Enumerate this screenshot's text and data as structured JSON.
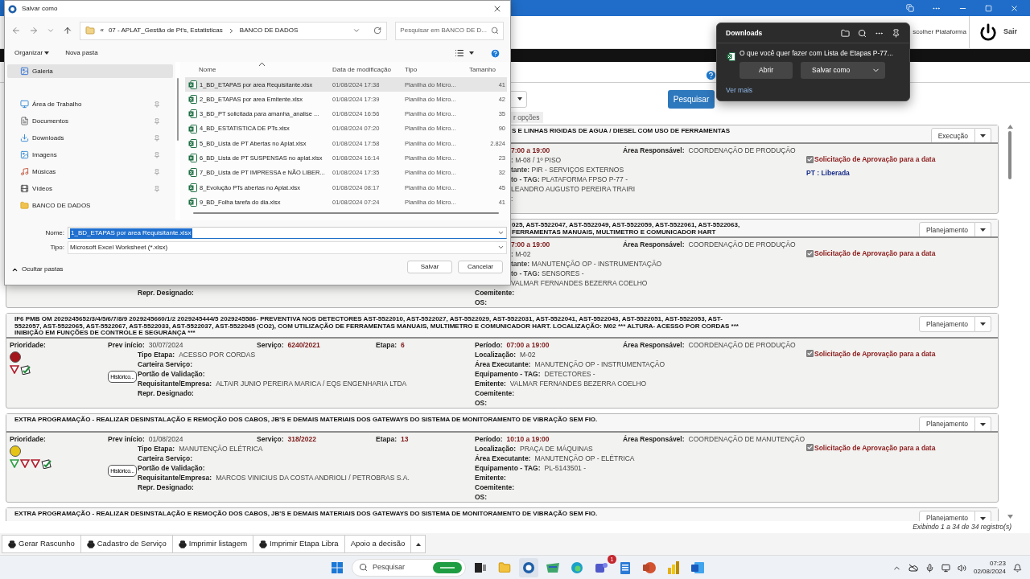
{
  "header": {
    "platform_link": "scolher Plataforma",
    "exit_label": "Sair"
  },
  "search": {
    "button": "Pesquisar",
    "tab": "r opções"
  },
  "cards": [
    {
      "kind": "partial",
      "title": "S E LINHAS RIGIDAS DE AGUA / DIESEL COM USO DE FERRAMENTAS",
      "status": "Execução",
      "rows": [
        {
          "mid": {
            "kind": "fragment",
            "text": "7:00 a 19:00"
          }
        },
        {
          "mid": {
            "kind": "fragment",
            "text": "**:** M-08 / 1º PISO"
          }
        },
        {
          "mid": {
            "kind": "fragment",
            "text": "**tante:** PIR - SERVIÇOS EXTERNOS"
          }
        },
        {
          "mid": {
            "kind": "fragment",
            "text": "**to - TAG:** PLATAFORMA FPSO P-77 -"
          }
        },
        {
          "mid": {
            "kind": "fragment",
            "text": "LEANDRO AUGUSTO PEREIRA TRAIRI"
          }
        },
        {
          "mid": {
            "kind": "fragment",
            "text": ":"
          }
        }
      ],
      "area": {
        "label": "Área Responsável:",
        "value": "COORDENAÇÃO DE PRODUÇÃO"
      },
      "approval": {
        "checked": true,
        "text": "Solicitação de Aprovação para a data"
      },
      "pt_status": "PT : Liberada"
    },
    {
      "kind": "partial",
      "title": "025, AST-5522047, AST-5522049, AST-5522059, AST-5522061, AST-5522063,\nFERRAMENTAS MANUAIS, MULTIMETRO E COMUNICADOR HART",
      "status": "Planejamento",
      "rows": [
        {
          "mid": {
            "kind": "fragment",
            "text": "7:00 a 19:00"
          }
        },
        {
          "mid": {
            "kind": "fragment",
            "text": "**:** M-02"
          }
        },
        {
          "mid": {
            "kind": "fragment",
            "text": "**tante:** MANUTENÇÃO OP - INSTRUMENTAÇÃO"
          }
        },
        {
          "mid": {
            "kind": "fragment",
            "text": "**to - TAG:** SENSORES -"
          }
        },
        {
          "mid": {
            "kind": "fragment",
            "text": "VALMAR FERNANDES BEZERRA COELHO"
          }
        },
        {
          "left": {
            "label": "Repr. Designado:"
          },
          "mid": {
            "kind": "field",
            "label": "Coemitente:"
          }
        },
        {
          "mid": {
            "kind": "field",
            "label": "OS:"
          }
        }
      ],
      "area": {
        "label": "Área Responsável:",
        "value": "COORDENAÇÃO DE PRODUÇÃO"
      },
      "approval": {
        "checked": true,
        "text": "Solicitação de Aprovação para a data"
      }
    },
    {
      "kind": "full",
      "title": "IF6 PMB OM 2029245652/3/4/5/6/7/8/9 2029245660/1/2 2029245444/5 2029245586- PREVENTIVA NOS DETECTORES AST-5522010, AST-5522027, AST-5522029, AST-5522031, AST-5522041, AST-5522043, AST-5522051, AST-5522053, AST-\n5522057, AST-5522065, AST-5522067, AST-5522033, AST-5522037, AST-5522045 (CO2), COM UTILIZAÇÃO DE FERRAMENTAS MANUAIS, MULTIMETRO E COMUNICADOR HART. LOCALIZAÇÃO: M02 *** ALTURA- ACESSO POR CORDAS ***\nINIBIÇÃO EM FUNÇÕES DE CONTROLE E SEGURANÇA ***",
      "status": "Planejamento",
      "priority_label": "Prioridade:",
      "color": "#a3161b",
      "flags": [
        {
          "color": "#b01c2c"
        }
      ],
      "history": "Histórico...",
      "prev": {
        "label": "Prev início:",
        "value": "30/07/2024"
      },
      "service": {
        "label": "Serviço:",
        "value": "6240/2021"
      },
      "stage": {
        "label": "Etapa:",
        "value": "6"
      },
      "left_fields": [
        {
          "label": "Tipo Etapa:",
          "value": "ACESSO POR CORDAS"
        },
        {
          "label": "Carteira Serviço:"
        },
        {
          "label": "Portão de Validação:"
        },
        {
          "label": "Requisitante/Empresa:",
          "value": "ALTAIR JUNIO PEREIRA MARICA / EQS ENGENHARIA LTDA"
        },
        {
          "label": "Repr. Designado:"
        }
      ],
      "period": {
        "label": "Período:",
        "value": "07:00 a 19:00"
      },
      "right_fields": [
        {
          "label": "Localização:",
          "value": "M-02"
        },
        {
          "label": "Área Executante:",
          "value": "MANUTENÇÃO OP - INSTRUMENTAÇÃO"
        },
        {
          "label": "Equipamento - TAG:",
          "value": "DETECTORES -"
        },
        {
          "label": "Emitente:",
          "value": "VALMAR FERNANDES BEZERRA COELHO"
        },
        {
          "label": "Coemitente:"
        },
        {
          "label": "OS:"
        }
      ],
      "area": {
        "label": "Área Responsável:",
        "value": "COORDENAÇÃO DE PRODUÇÃO"
      },
      "approval": {
        "checked": true,
        "text": "Solicitação de Aprovação para a data"
      }
    },
    {
      "kind": "full",
      "title": "EXTRA PROGRAMAÇÃO - REALIZAR DESINSTALAÇÃO E REMOÇÃO DOS CABOS, JB'S E DEMAIS MATERIAIS DOS GATEWAYS DO SISTEMA DE MONITORAMENTO DE VIBRAÇÃO SEM FIO.",
      "status": "Planejamento",
      "priority_label": "Prioridade:",
      "color": "#e6c416",
      "flags": [
        {
          "color": "#2f9e44"
        },
        {
          "color": "#b01c2c"
        },
        {
          "color": "#b01c2c"
        }
      ],
      "history": "Histórico...",
      "prev": {
        "label": "Prev início:",
        "value": "01/08/2024"
      },
      "service": {
        "label": "Serviço:",
        "value": "318/2022"
      },
      "stage": {
        "label": "Etapa:",
        "value": "13"
      },
      "left_fields": [
        {
          "label": "Tipo Etapa:",
          "value": "MANUTENÇÃO ELÉTRICA"
        },
        {
          "label": "Carteira Serviço:"
        },
        {
          "label": "Portão de Validação:"
        },
        {
          "label": "Requisitante/Empresa:",
          "value": "MARCOS VINICIUS DA COSTA ANDRIOLI / PETROBRAS S.A."
        },
        {
          "label": "Repr. Designado:"
        }
      ],
      "period": {
        "label": "Período:",
        "value": "10:10 a 19:00"
      },
      "right_fields": [
        {
          "label": "Localização:",
          "value": "PRAÇA DE MÁQUINAS"
        },
        {
          "label": "Área Executante:",
          "value": "MANUTENÇÃO OP - ELÉTRICA"
        },
        {
          "label": "Equipamento - TAG:",
          "value": "PL-5143501 -"
        },
        {
          "label": "Emitente:"
        },
        {
          "label": "Coemitente:"
        },
        {
          "label": "OS:"
        }
      ],
      "area": {
        "label": "Área Responsável:",
        "value": "COORDENAÇÃO DE MANUTENÇÃO"
      },
      "approval": {
        "checked": true,
        "text": "Solicitação de Aprovação para a data"
      }
    },
    {
      "kind": "clipped",
      "title": "EXTRA PROGRAMAÇÃO - REALIZAR DESINSTALAÇÃO E REMOÇÃO DOS CABOS, JB'S E DEMAIS MATERIAIS DOS GATEWAYS DO SISTEMA DE MONITORAMENTO DE VIBRAÇÃO SEM FIO.",
      "status": "Planejamento"
    }
  ],
  "records": "Exibindo 1 a 34 de 34 registro(s)",
  "toolbar": [
    {
      "label": "Gerar Rascunho",
      "kind": "print"
    },
    {
      "label": "Cadastro de Serviço",
      "kind": "print"
    },
    {
      "label": "Imprimir listagem",
      "kind": "print"
    },
    {
      "label": "Imprimir Etapa Libra",
      "kind": "print"
    },
    {
      "label": "Apoio a decisão",
      "kind": "plain"
    }
  ],
  "dialog": {
    "title": "Salvar como",
    "path_prefix": "«",
    "path": [
      "07 - APLAT_Gestão de Pt's, Estatisticas",
      "BANCO DE DADOS"
    ],
    "search_placeholder": "Pesquisar em BANCO DE D...",
    "organize": "Organizar",
    "new_folder": "Nova pasta",
    "nav": [
      {
        "label": "Galeria",
        "kind": "gallery",
        "selected": true,
        "pinned": false
      },
      {
        "label": "Área de Trabalho",
        "kind": "desktop",
        "selected": false,
        "pinned": true
      },
      {
        "label": "Documentos",
        "kind": "documents",
        "selected": false,
        "pinned": true
      },
      {
        "label": "Downloads",
        "kind": "downloads",
        "selected": false,
        "pinned": true
      },
      {
        "label": "Imagens",
        "kind": "images",
        "selected": false,
        "pinned": true
      },
      {
        "label": "Músicas",
        "kind": "music",
        "selected": false,
        "pinned": true
      },
      {
        "label": "Vídeos",
        "kind": "videos",
        "selected": false,
        "pinned": true
      },
      {
        "label": "BANCO DE DADOS",
        "kind": "folder",
        "selected": false,
        "pinned": false
      }
    ],
    "columns": [
      "Nome",
      "Data de modificação",
      "Tipo",
      "Tamanho"
    ],
    "files": [
      {
        "name": "1_BD_ETAPAS por area Requisitante.xlsx",
        "date": "01/08/2024 17:38",
        "type": "Planilha do Micro...",
        "size": "41",
        "selected": true
      },
      {
        "name": "2_BD_ETAPAS por area Emitente.xlsx",
        "date": "01/08/2024 17:39",
        "type": "Planilha do Micro...",
        "size": "42",
        "selected": false
      },
      {
        "name": "3_BD_PT solicitada para amanha_analise ...",
        "date": "01/08/2024 16:56",
        "type": "Planilha do Micro...",
        "size": "35",
        "selected": false
      },
      {
        "name": "4_BD_ESTATISTICA DE PTs.xlsx",
        "date": "01/08/2024 07:20",
        "type": "Planilha do Micro...",
        "size": "90",
        "selected": false
      },
      {
        "name": "5_BD_Lista de PT Abertas no Aplat.xlsx",
        "date": "01/08/2024 17:58",
        "type": "Planilha do Micro...",
        "size": "2.824",
        "selected": false
      },
      {
        "name": "6_BD_Lista de PT SUSPENSAS no aplat.xlsx",
        "date": "01/08/2024 16:14",
        "type": "Planilha do Micro...",
        "size": "23",
        "selected": false
      },
      {
        "name": "7_BD_Lista de PT IMPRESSA e NÃO LIBER...",
        "date": "01/08/2024 17:35",
        "type": "Planilha do Micro...",
        "size": "32",
        "selected": false
      },
      {
        "name": "8_Evolução PTs abertas no Aplat.xlsx",
        "date": "01/08/2024 08:17",
        "type": "Planilha do Micro...",
        "size": "45",
        "selected": false
      },
      {
        "name": "9_BD_Folha tarefa do dia.xlsx",
        "date": "01/08/2024 07:24",
        "type": "Planilha do Micro...",
        "size": "41",
        "selected": false
      }
    ],
    "name_label": "Nome:",
    "name_value": "1_BD_ETAPAS por area Requisitante.xlsx",
    "type_label": "Tipo:",
    "type_value": "Microsoft Excel Worksheet (*.xlsx)",
    "hide_folders": "Ocultar pastas",
    "save": "Salvar",
    "cancel": "Cancelar"
  },
  "downloads": {
    "title": "Downloads",
    "message": "O que você quer fazer com Lista de Etapas P-77...",
    "open": "Abrir",
    "save_as": "Salvar como",
    "more": "Ver mais"
  },
  "taskbar": {
    "search_placeholder": "Pesquisar",
    "badge": "1",
    "time": "07:23",
    "date": "02/08/2024"
  }
}
